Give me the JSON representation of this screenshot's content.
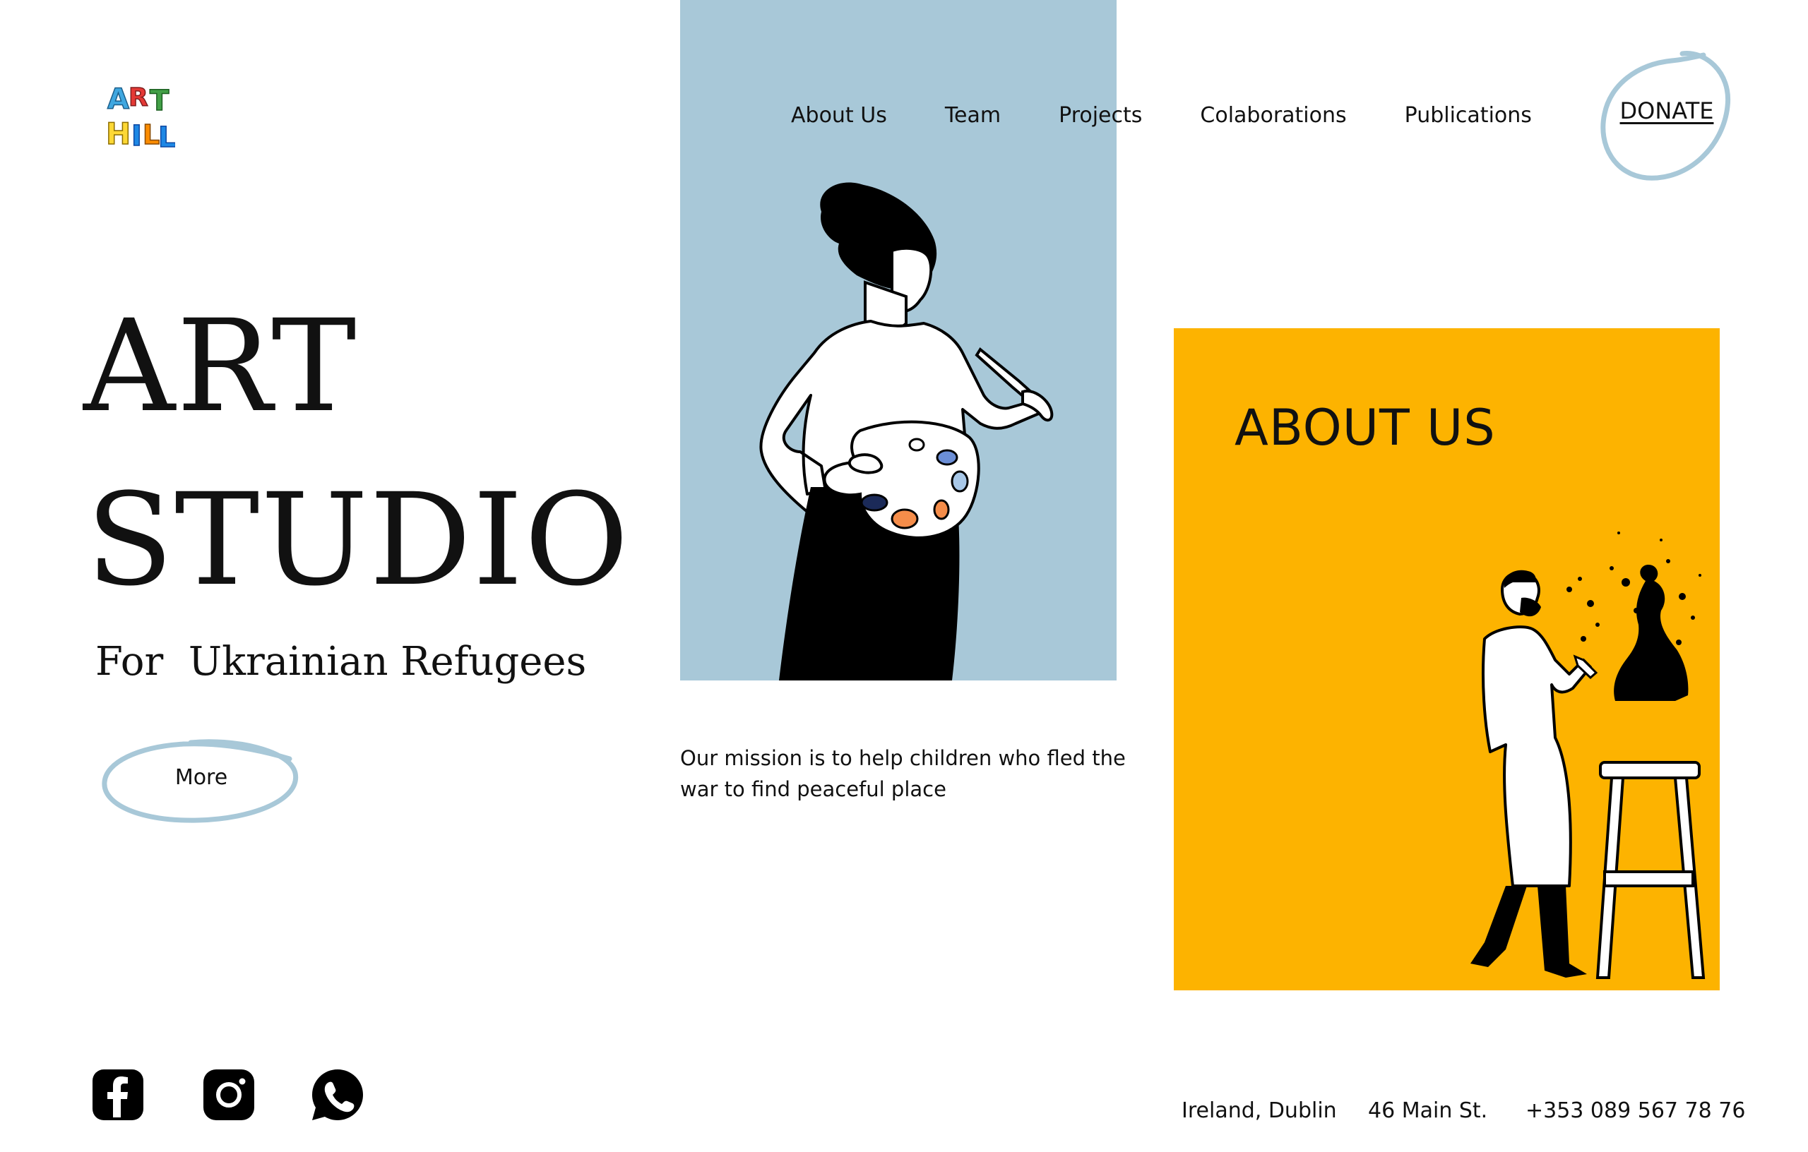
{
  "brand": {
    "logo_icon": "art-hill-logo",
    "logo_letters": [
      "A",
      "R",
      "T",
      "H",
      "I",
      "L",
      "L"
    ],
    "logo_colors": [
      "#3fa7e0",
      "#e53935",
      "#43a047",
      "#fdd835",
      "#1e88e5",
      "#fb8c00",
      "#1e88e5"
    ]
  },
  "nav": {
    "items": [
      {
        "label": "About Us"
      },
      {
        "label": "Team"
      },
      {
        "label": "Projects"
      },
      {
        "label": "Colaborations"
      },
      {
        "label": "Publications"
      }
    ],
    "donate_label": "DONATE"
  },
  "hero": {
    "title_line1": "ART",
    "title_line2": "STUDIO",
    "subtitle": "For  Ukrainian Refugees",
    "more_label": "More"
  },
  "mission": {
    "text": "Our mission is to help children who fled the war to find peaceful place"
  },
  "about": {
    "title": "ABOUT US"
  },
  "socials": [
    {
      "icon": "facebook-icon"
    },
    {
      "icon": "instagram-icon"
    },
    {
      "icon": "whatsapp-icon"
    }
  ],
  "footer": {
    "location": "Ireland, Dublin",
    "address": "46 Main St.",
    "phone": "+353 089 567 78 76"
  },
  "colors": {
    "panel_blue": "#a8c8d8",
    "accent_yellow": "#fdb300",
    "circle_stroke": "#a8c8d8",
    "text": "#111111"
  }
}
